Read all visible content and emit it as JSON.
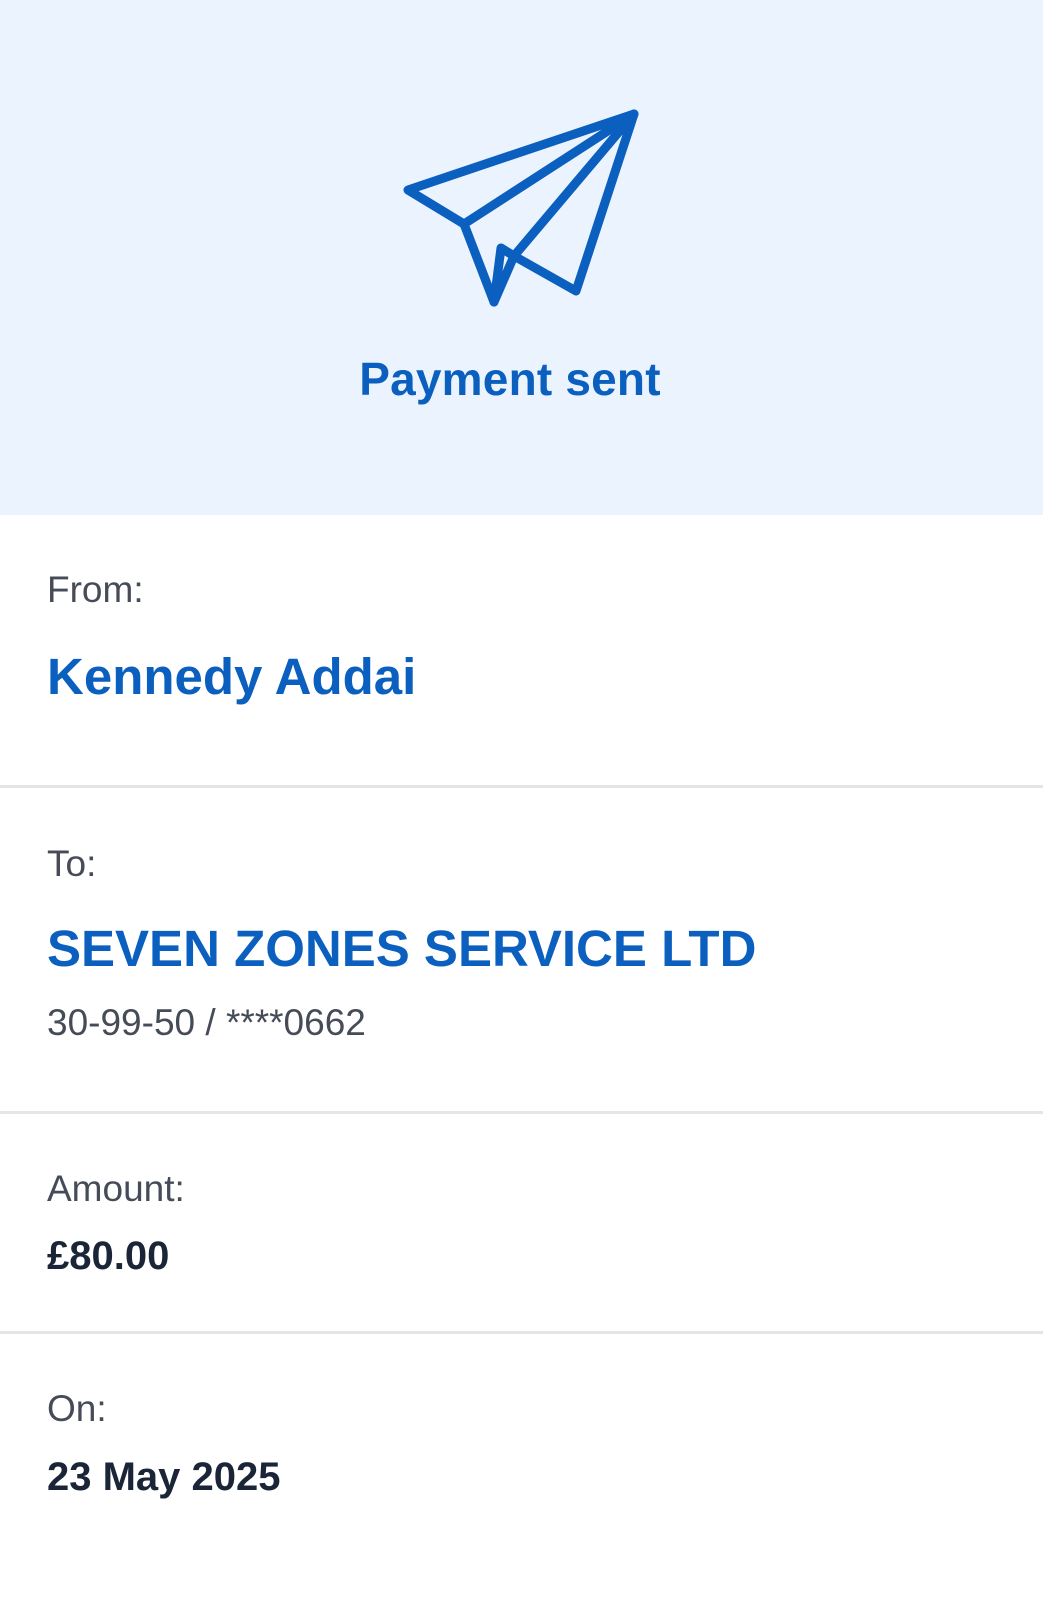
{
  "header": {
    "title": "Payment sent",
    "icon": "paper-plane-icon",
    "accent_color": "#0a5fbf",
    "background_color": "#ebf4fe"
  },
  "from": {
    "label": "From:",
    "name": "Kennedy Addai"
  },
  "to": {
    "label": "To:",
    "name": "SEVEN ZONES SERVICE LTD",
    "account": "30-99-50 / ****0662"
  },
  "amount": {
    "label": "Amount:",
    "value": "£80.00"
  },
  "date": {
    "label": "On:",
    "value": "23 May 2025"
  }
}
